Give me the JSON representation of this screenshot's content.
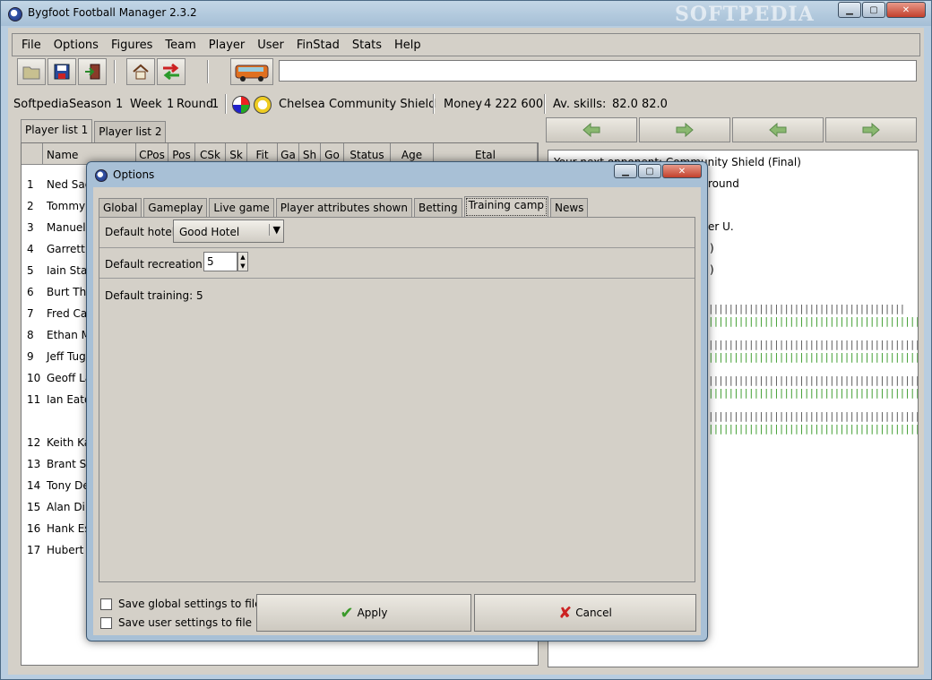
{
  "window": {
    "title": "Bygfoot Football Manager 2.3.2",
    "watermark": "SOFTPEDIA"
  },
  "menu": [
    "File",
    "Options",
    "Figures",
    "Team",
    "Player",
    "User",
    "FinStad",
    "Stats",
    "Help"
  ],
  "infobar": {
    "user": "Softpedia",
    "season_label": "Season",
    "season": "1",
    "week_label": "Week",
    "week": "1",
    "round_label": "Round",
    "round": "1",
    "team": "Chelsea",
    "competition": "Community Shield",
    "money_label": "Money",
    "money": "4 222 600",
    "avskills_label": "Av. skills:",
    "avskills1": "82.0",
    "avskills2": "82.0"
  },
  "left_tabs": [
    "Player list 1",
    "Player list 2"
  ],
  "table_headers": [
    "Name",
    "CPos",
    "Pos",
    "CSk",
    "Sk",
    "Fit",
    "Ga",
    "Sh",
    "Go",
    "Status",
    "Age",
    "Etal"
  ],
  "players": [
    {
      "num": "1",
      "name": "Ned Sag"
    },
    {
      "num": "2",
      "name": "Tommy"
    },
    {
      "num": "3",
      "name": "Manuel"
    },
    {
      "num": "4",
      "name": "Garrett"
    },
    {
      "num": "5",
      "name": "Iain Sta"
    },
    {
      "num": "6",
      "name": "Burt Tho"
    },
    {
      "num": "7",
      "name": "Fred Ca"
    },
    {
      "num": "8",
      "name": "Ethan M"
    },
    {
      "num": "9",
      "name": "Jeff Tug"
    },
    {
      "num": "10",
      "name": "Geoff La"
    },
    {
      "num": "11",
      "name": "Ian Eato"
    },
    {
      "num": "12",
      "name": "Keith Ka"
    },
    {
      "num": "13",
      "name": "Brant St"
    },
    {
      "num": "14",
      "name": "Tony De"
    },
    {
      "num": "15",
      "name": "Alan Dil"
    },
    {
      "num": "16",
      "name": "Hank Es"
    },
    {
      "num": "17",
      "name": "Hubert T"
    }
  ],
  "right_panel": {
    "line1": "Your next opponent: Community Shield (Final)",
    "line2": "round",
    "line3": "er U.",
    "line4": ")",
    "line5": ")"
  },
  "dialog": {
    "title": "Options",
    "tabs": [
      "Global",
      "Gameplay",
      "Live game",
      "Player attributes shown",
      "Betting",
      "Training camp",
      "News"
    ],
    "active_tab": "Training camp",
    "default_hotel_label": "Default hotel",
    "default_hotel_value": "Good Hotel",
    "default_recreation_label": "Default recreation:",
    "default_recreation_value": "5",
    "default_training_text": "Default training: 5",
    "save_global": "Save global settings to file",
    "save_user": "Save user settings to file",
    "apply": "Apply",
    "cancel": "Cancel"
  },
  "colors": {
    "check_green": "#3a9a2a",
    "cancel_red": "#cc2222",
    "arrow_green": "#5aa83a"
  }
}
